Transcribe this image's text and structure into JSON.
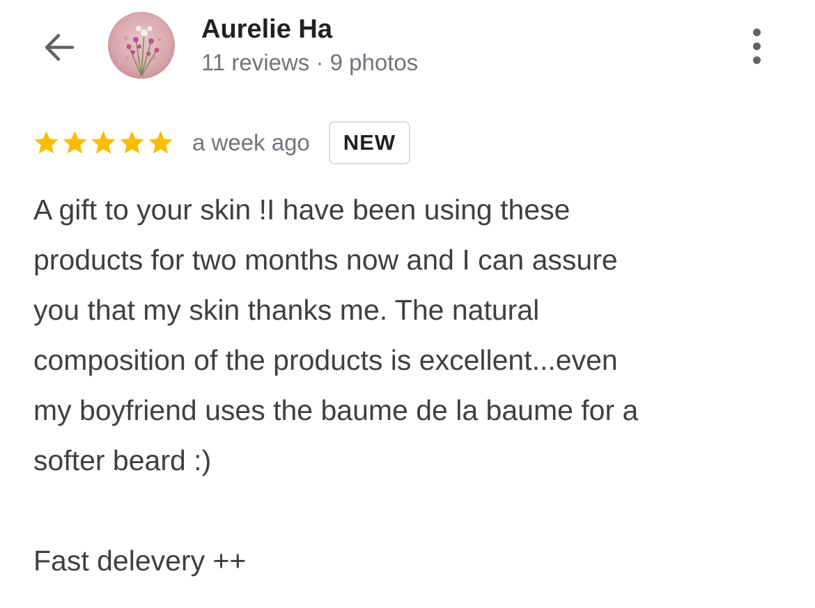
{
  "header": {
    "back_icon": "arrow-back-icon",
    "author_name": "Aurelie Ha",
    "author_meta": "11 reviews · 9 photos",
    "avatar_icon": "profile-photo-flowers",
    "more_icon": "more-vert-icon"
  },
  "review": {
    "rating": 5,
    "rating_max": 5,
    "star_color": "#fbbc04",
    "time": "a week ago",
    "badge": "NEW",
    "lines": [
      "A gift to your skin !I have been using these",
      "products for two months now and I can assure",
      "you that my skin thanks me. The natural",
      "composition of the products is excellent...even",
      "my boyfriend uses the baume de la baume for a",
      "softer beard :)"
    ],
    "extra_line": "Fast delevery ++"
  },
  "colors": {
    "text_primary": "#202124",
    "text_body": "#3c4043",
    "text_secondary": "#70757a",
    "star": "#fbbc04",
    "badge_border": "#dadce0"
  }
}
